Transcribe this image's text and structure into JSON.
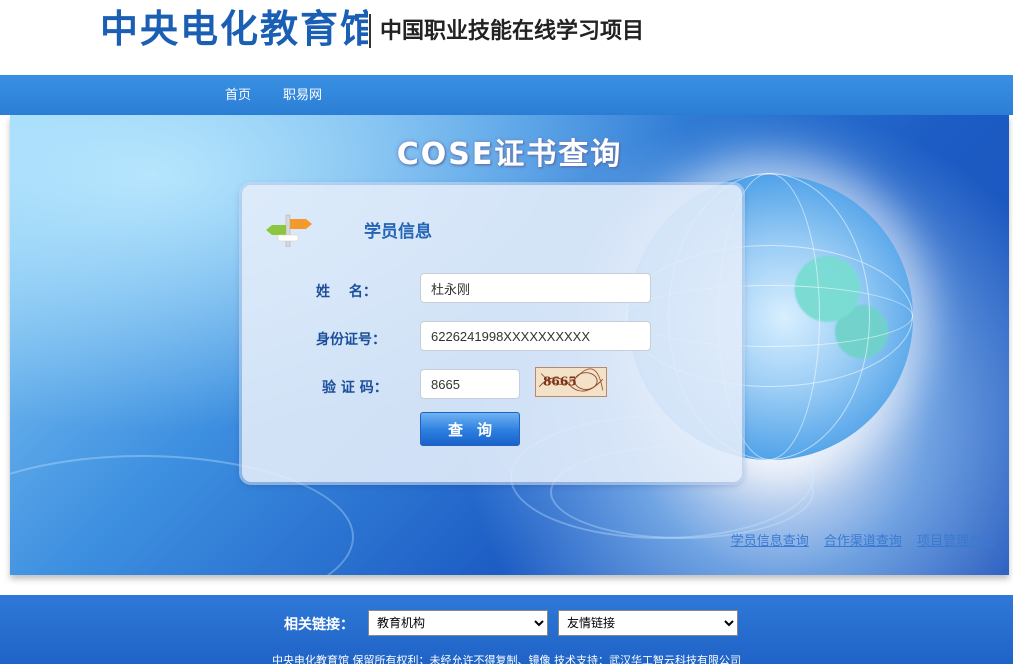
{
  "header": {
    "logo_text": "中央电化教育馆",
    "subtitle": "中国职业技能在线学习项目"
  },
  "nav": {
    "items": [
      {
        "label": "首页"
      },
      {
        "label": "职易网"
      }
    ]
  },
  "banner": {
    "title": "COSE证书查询"
  },
  "form": {
    "heading": "学员信息",
    "name_label": "姓　 名：",
    "name_value": "杜永刚",
    "id_label": "身份证号：",
    "id_value": "6226241998XXXXXXXXXX",
    "captcha_label": "验 证 码：",
    "captcha_value": "8665",
    "captcha_image_text": "8665",
    "submit_label": "查询"
  },
  "banner_links": [
    {
      "label": "学员信息查询"
    },
    {
      "label": "合作渠道查询"
    },
    {
      "label": "项目管理办法"
    }
  ],
  "footer": {
    "related_label": "相关链接：",
    "select_edu": "教育机构",
    "select_friend": "友情链接",
    "copyright": "中央电化教育馆 保留所有权利；未经允许不得复制、镜像 技术支持：武汉华工智云科技有限公司"
  }
}
